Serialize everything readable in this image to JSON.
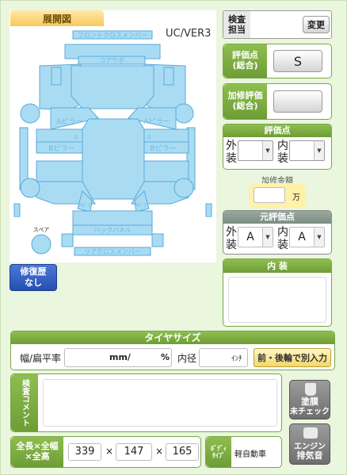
{
  "diagram": {
    "tab_label": "展開図",
    "version": "UC/VER3",
    "parts": {
      "front_cross_member": "フロントクロスメンバー",
      "core_support": "コアサポ",
      "a_pillar_left": "Aピラー",
      "a_pillar_right": "Aピラー",
      "b_pillar_left": "Bピラー",
      "b_pillar_right": "Bピラー",
      "pillar_mark_left": "0",
      "pillar_mark_right": "0",
      "rear_left": "ﾘﾔﾋﾟﾗｰ",
      "rear_right": "ﾘﾔﾋﾟﾗｰ",
      "back_panel": "バックパネル",
      "rear_cross_member": "リアクロスメンバー",
      "spare": "スペア"
    }
  },
  "repair_history": {
    "line1": "修復歴",
    "line2": "なし"
  },
  "inspector": {
    "label_line1": "検査",
    "label_line2": "担当",
    "change_button": "変更"
  },
  "overall_score": {
    "label_line1": "評価点",
    "label_line2": "(総合)",
    "value": "S"
  },
  "repair_eval": {
    "label_line1": "加修評価",
    "label_line2": "(総合)",
    "value": ""
  },
  "score": {
    "title": "評価点",
    "exterior_line1": "外",
    "exterior_line2": "装",
    "interior_line1": "内",
    "interior_line2": "装",
    "exterior_value": "",
    "interior_value": ""
  },
  "repair_amount": {
    "label": "加修金額",
    "value": "",
    "unit": "万"
  },
  "original_score": {
    "title": "元評価点",
    "exterior_line1": "外",
    "exterior_line2": "装",
    "interior_line1": "内",
    "interior_line2": "装",
    "exterior_value": "A",
    "interior_value": "A"
  },
  "interior_panel": {
    "title": "内 装",
    "text": ""
  },
  "tire": {
    "title": "タイヤサイズ",
    "width_label": "幅/扁平率",
    "mm_unit": "mm/",
    "pct_unit": "%",
    "diameter_label": "内径",
    "inch_unit": "ｲﾝﾁ",
    "separate_button": "前・後輪で別入力"
  },
  "inspection_comment": {
    "label_line1": "検査",
    "label_line2": "コメント",
    "text": ""
  },
  "dimensions": {
    "label_line1": "全長×全幅",
    "label_line2": "×全高",
    "length": "339",
    "width": "147",
    "height": "165",
    "times": "×"
  },
  "body_type": {
    "label_line1": "ﾎﾞﾃﾞｨ",
    "label_line2": "ﾀｲﾌﾟ",
    "value": "軽自動車"
  },
  "paint_button": {
    "line1": "塗膜",
    "line2": "未チェック"
  },
  "engine_button": {
    "line1": "エンジン",
    "line2": "排気音"
  },
  "colors": {
    "green_head": "#7cab40",
    "part_fill": "#a9dcf3",
    "part_stroke": "#5aaad8",
    "repair_blue": "#2f5fc4",
    "yellow": "#fff2a8"
  }
}
